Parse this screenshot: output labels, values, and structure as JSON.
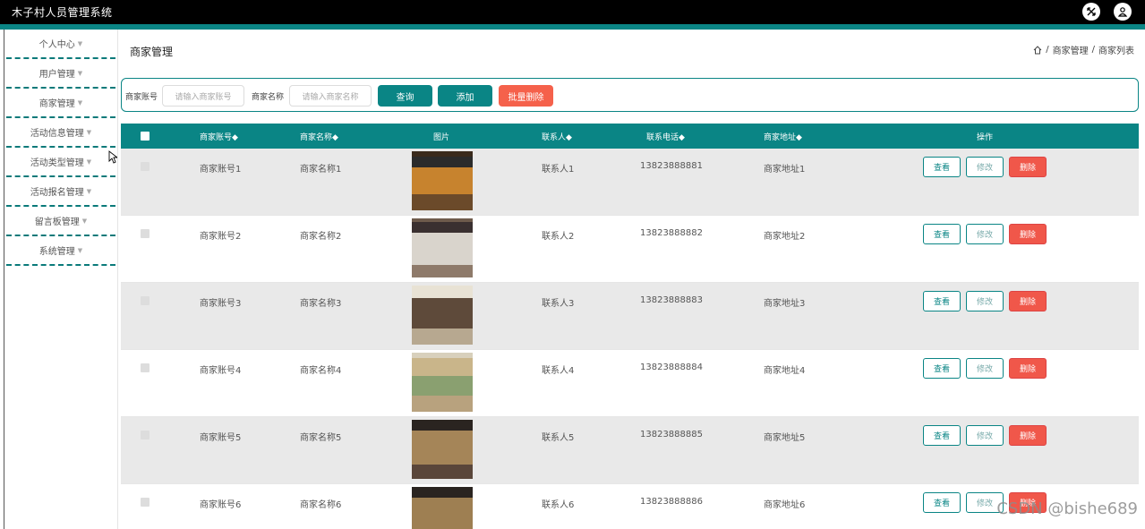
{
  "app": {
    "title": "木子村人员管理系统"
  },
  "sidebar": {
    "items": [
      {
        "label": "个人中心"
      },
      {
        "label": "用户管理"
      },
      {
        "label": "商家管理"
      },
      {
        "label": "活动信息管理"
      },
      {
        "label": "活动类型管理"
      },
      {
        "label": "活动报名管理"
      },
      {
        "label": "留言板管理"
      },
      {
        "label": "系统管理"
      }
    ]
  },
  "main": {
    "title": "商家管理",
    "breadcrumb": {
      "sep": "/",
      "level1": "商家管理",
      "level2": "商家列表"
    }
  },
  "search": {
    "account_label": "商家账号",
    "account_placeholder": "请输入商家账号",
    "name_label": "商家名称",
    "name_placeholder": "请输入商家名称",
    "search_button": "查询",
    "add_button": "添加",
    "batch_delete_button": "批量删除"
  },
  "table": {
    "headers": {
      "account": "商家账号◆",
      "name": "商家名称◆",
      "image": "图片",
      "contact": "联系人◆",
      "phone": "联系电话◆",
      "address": "商家地址◆",
      "actions": "操作"
    },
    "actions": {
      "view": "查看",
      "edit": "修改",
      "delete": "删除"
    },
    "rows": [
      {
        "account": "商家账号1",
        "name": "商家名称1",
        "contact": "联系人1",
        "phone": "13823888881",
        "address": "商家地址1"
      },
      {
        "account": "商家账号2",
        "name": "商家名称2",
        "contact": "联系人2",
        "phone": "13823888882",
        "address": "商家地址2"
      },
      {
        "account": "商家账号3",
        "name": "商家名称3",
        "contact": "联系人3",
        "phone": "13823888883",
        "address": "商家地址3"
      },
      {
        "account": "商家账号4",
        "name": "商家名称4",
        "contact": "联系人4",
        "phone": "13823888884",
        "address": "商家地址4"
      },
      {
        "account": "商家账号5",
        "name": "商家名称5",
        "contact": "联系人5",
        "phone": "13823888885",
        "address": "商家地址5"
      },
      {
        "account": "商家账号6",
        "name": "商家名称6",
        "contact": "联系人6",
        "phone": "13823888886",
        "address": "商家地址6"
      }
    ]
  },
  "watermark": "CSDN @bishe689",
  "colors": {
    "accent": "#0a8585",
    "danger": "#f5614b",
    "topbar": "#000000"
  }
}
